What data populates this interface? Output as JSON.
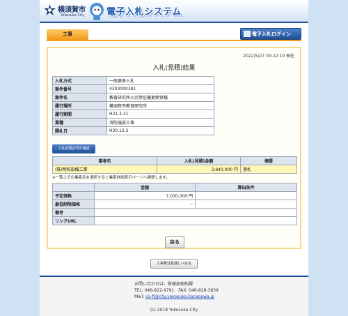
{
  "header": {
    "city_name": "横須賀市",
    "city_sub": "Yokosuka City",
    "system_title": "電子入札システム"
  },
  "tabs": {
    "active": "工事",
    "login": "電子入札ログイン"
  },
  "result": {
    "datetime": "2022/5/27 00:22:10 現在",
    "title": "入札(見積)結果",
    "info": [
      {
        "label": "入札方式",
        "value": "一般競争入札"
      },
      {
        "label": "案件番号",
        "value": "4303000381"
      },
      {
        "label": "案件名",
        "value": "教育研究所火災受信機更新修繕"
      },
      {
        "label": "履行場所",
        "value": "横須賀市教育研究所"
      },
      {
        "label": "履行期間",
        "value": "H31.3.31"
      },
      {
        "label": "業種",
        "value": "消防施設工事"
      },
      {
        "label": "開札日",
        "value": "H30.12.5"
      }
    ],
    "history_button": "入札処理記号の確認",
    "bids_headers": {
      "company": "業者名",
      "amount": "入札(見積)金額",
      "summary": "摘要"
    },
    "bids": [
      {
        "company": "(株)明和設備工業",
        "amount": "3,840,000 円",
        "summary": "落札"
      }
    ],
    "note": "※一覧上での業者名を選択すると業者詳細表示ページへ遷移します。",
    "price_headers": {
      "amount": "金額",
      "condition": "算出条件"
    },
    "price_rows": [
      {
        "label": "予定価格",
        "amount": "7,030,000 円",
        "condition": ""
      },
      {
        "label": "最低制限価格",
        "amount": "--",
        "condition": ""
      },
      {
        "label": "備考",
        "amount": "",
        "condition": ""
      },
      {
        "label": "リンクURL",
        "amount": "",
        "condition": ""
      }
    ],
    "back_button": "戻る",
    "search_button": "工事発注見通しへ戻る"
  },
  "footer": {
    "line1": "お問い合わせは、財務部契約課",
    "line2": "TEL: 046-822-9791　FAX: 046-828-3839",
    "mail_label": "Mail: ",
    "mail": "co-fi@city.yokosuka.kanagawa.jp",
    "copyright": "(c) 2018 Yokosuka City"
  },
  "colors": {
    "brand_blue": "#1e4f96",
    "tab_orange": "#f39a1c",
    "win_row": "#fff8b8"
  },
  "icons": [
    "city-emblem-icon",
    "mascot-icon",
    "login-icon"
  ]
}
